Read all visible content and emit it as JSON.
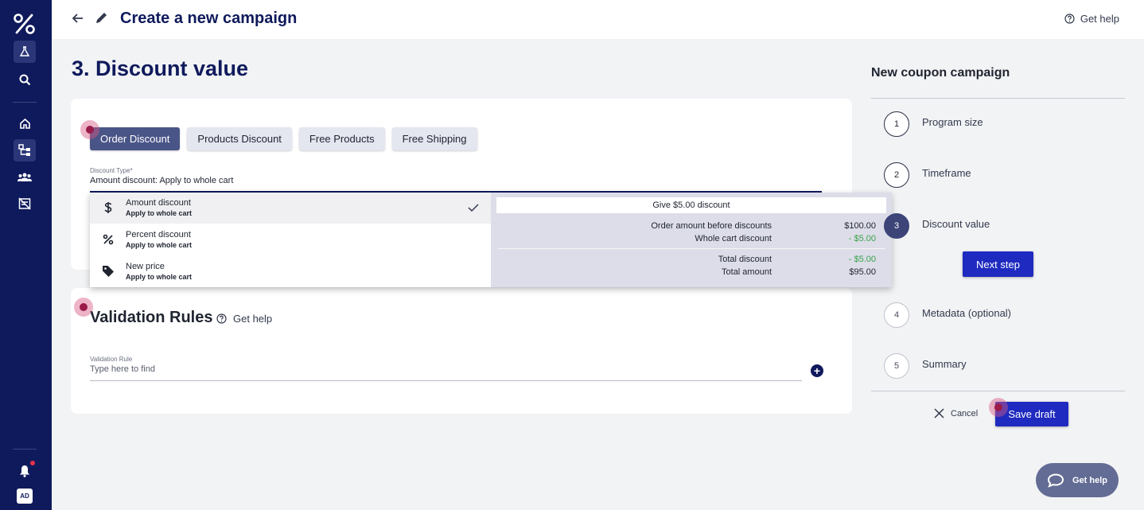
{
  "header": {
    "title": "Create a new campaign",
    "help_label": "Get help"
  },
  "sidebar": {
    "avatar_initials": "AD",
    "icons": [
      "logo-icon",
      "lab-icon",
      "search-icon",
      "home-icon",
      "campaigns-icon",
      "customers-icon",
      "distributions-icon",
      "bell-icon"
    ]
  },
  "section": {
    "title": "3. Discount value"
  },
  "discount_tabs": [
    {
      "label": "Order Discount",
      "active": true
    },
    {
      "label": "Products Discount",
      "active": false
    },
    {
      "label": "Free Products",
      "active": false
    },
    {
      "label": "Free Shipping",
      "active": false
    }
  ],
  "discount_type": {
    "label": "Discount Type*",
    "value": "Amount discount: Apply to whole cart"
  },
  "dropdown": {
    "options": [
      {
        "title": "Amount discount",
        "subtitle": "Apply to whole cart",
        "icon": "dollar-icon",
        "selected": true
      },
      {
        "title": "Percent discount",
        "subtitle": "Apply to whole cart",
        "icon": "percent-icon",
        "selected": false
      },
      {
        "title": "New price",
        "subtitle": "Apply to whole cart",
        "icon": "tag-icon",
        "selected": false
      }
    ],
    "preview": {
      "heading": "Give $5.00 discount",
      "rows": [
        {
          "label": "Order amount before discounts",
          "value": "$100.00"
        },
        {
          "label": "Whole cart discount",
          "value": "- $5.00"
        },
        {
          "label": "Total discount",
          "value": "- $5.00"
        },
        {
          "label": "Total amount",
          "value": "$95.00"
        }
      ]
    }
  },
  "validation": {
    "title": "Validation Rules",
    "help_label": "Get help",
    "field_label": "Validation Rule",
    "placeholder": "Type here to find"
  },
  "panel": {
    "title": "New coupon campaign",
    "steps": [
      {
        "number": "1",
        "label": "Program size",
        "state": "done"
      },
      {
        "number": "2",
        "label": "Timeframe",
        "state": "done"
      },
      {
        "number": "3",
        "label": "Discount value",
        "state": "current"
      },
      {
        "number": "4",
        "label": "Metadata (optional)",
        "state": "todo"
      },
      {
        "number": "5",
        "label": "Summary",
        "state": "todo"
      }
    ],
    "next_step_label": "Next step",
    "cancel_label": "Cancel",
    "save_draft_label": "Save draft"
  },
  "help_fab": {
    "label": "Get help"
  },
  "colors": {
    "sidebar": "#0f1a5c",
    "primary_button": "#1e2ac0",
    "active_tab": "#4a5587",
    "discount_green": "#3aa24b",
    "current_step": "#3c4478"
  }
}
